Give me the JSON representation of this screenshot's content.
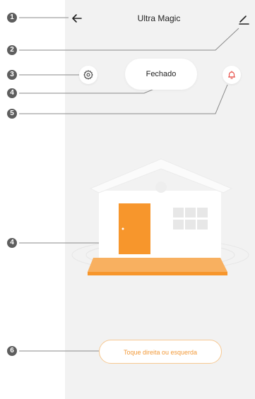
{
  "header": {
    "title": "Ultra Magic"
  },
  "status": {
    "label": "Fechado"
  },
  "action": {
    "label": "Toque direita ou esquerda"
  },
  "callouts": [
    "1",
    "2",
    "3",
    "4",
    "5",
    "4",
    "6"
  ],
  "icons": {
    "back": "arrow-left-icon",
    "edit": "pencil-icon",
    "settings": "gear-icon",
    "notifications": "bell-icon",
    "house": "house-illustration"
  },
  "colors": {
    "accent": "#F7962C",
    "bell": "#E8544E",
    "callout": "#5E5E5E",
    "background": "#F2F2F2"
  }
}
